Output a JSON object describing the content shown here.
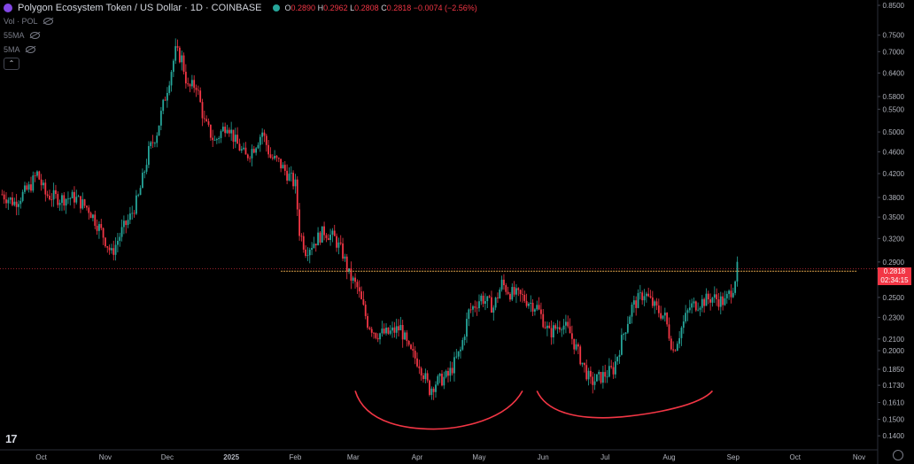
{
  "header": {
    "title": "Polygon Ecosystem Token / US Dollar · 1D · COINBASE",
    "ohlc": {
      "o_label": "O",
      "o": "0.2890",
      "h_label": "H",
      "h": "0.2962",
      "l_label": "L",
      "l": "0.2808",
      "c_label": "C",
      "c": "0.2818",
      "change": "−0.0074 (−2.56%)"
    }
  },
  "indicators": [
    "Vol · POL",
    "55MA",
    "5MA"
  ],
  "last_price": {
    "value": "0.2818",
    "countdown": "02:34:15"
  },
  "colors": {
    "up": "#26a69a",
    "down": "#f23645",
    "grid": "#2a2e39",
    "background": "#000000",
    "drawing": "#f23645"
  },
  "chart_data": {
    "type": "candlestick",
    "y_scale": "log",
    "ylim": [
      0.137,
      0.85
    ],
    "xlim": [
      "2024-09-11",
      "2025-11-10"
    ],
    "y_ticks": [
      "0.8500",
      "0.7500",
      "0.7000",
      "0.6400",
      "0.5800",
      "0.5500",
      "0.5000",
      "0.4600",
      "0.4200",
      "0.3800",
      "0.3500",
      "0.3200",
      "0.2900",
      "0.2700",
      "0.2500",
      "0.2300",
      "0.2100",
      "0.2000",
      "0.1850",
      "0.1730",
      "0.1610",
      "0.1500",
      "0.1400"
    ],
    "x_ticks": [
      {
        "label": "Oct",
        "date": "2024-10-01"
      },
      {
        "label": "Nov",
        "date": "2024-11-01"
      },
      {
        "label": "Dec",
        "date": "2024-12-01"
      },
      {
        "label": "2025",
        "date": "2025-01-01"
      },
      {
        "label": "Feb",
        "date": "2025-02-01"
      },
      {
        "label": "Mar",
        "date": "2025-03-01"
      },
      {
        "label": "Apr",
        "date": "2025-04-01"
      },
      {
        "label": "May",
        "date": "2025-05-01"
      },
      {
        "label": "Jun",
        "date": "2025-06-01"
      },
      {
        "label": "Jul",
        "date": "2025-07-01"
      },
      {
        "label": "Aug",
        "date": "2025-08-01"
      },
      {
        "label": "Sep",
        "date": "2025-09-01"
      },
      {
        "label": "Oct",
        "date": "2025-10-01"
      },
      {
        "label": "Nov",
        "date": "2025-11-01"
      }
    ],
    "close_path": [
      [
        "2024-09-12",
        0.385
      ],
      [
        "2024-09-18",
        0.372
      ],
      [
        "2024-09-25",
        0.395
      ],
      [
        "2024-09-29",
        0.42
      ],
      [
        "2024-10-03",
        0.385
      ],
      [
        "2024-10-10",
        0.378
      ],
      [
        "2024-10-17",
        0.38
      ],
      [
        "2024-10-24",
        0.362
      ],
      [
        "2024-10-30",
        0.33
      ],
      [
        "2024-11-04",
        0.3
      ],
      [
        "2024-11-09",
        0.33
      ],
      [
        "2024-11-13",
        0.35
      ],
      [
        "2024-11-17",
        0.38
      ],
      [
        "2024-11-22",
        0.46
      ],
      [
        "2024-11-26",
        0.5
      ],
      [
        "2024-11-30",
        0.58
      ],
      [
        "2024-12-05",
        0.7
      ],
      [
        "2024-12-08",
        0.68
      ],
      [
        "2024-12-11",
        0.6
      ],
      [
        "2024-12-15",
        0.61
      ],
      [
        "2024-12-19",
        0.52
      ],
      [
        "2024-12-24",
        0.48
      ],
      [
        "2024-12-30",
        0.52
      ],
      [
        "2025-01-03",
        0.48
      ],
      [
        "2025-01-08",
        0.45
      ],
      [
        "2025-01-12",
        0.47
      ],
      [
        "2025-01-16",
        0.5
      ],
      [
        "2025-01-20",
        0.45
      ],
      [
        "2025-01-24",
        0.44
      ],
      [
        "2025-01-28",
        0.42
      ],
      [
        "2025-02-01",
        0.4
      ],
      [
        "2025-02-03",
        0.33
      ],
      [
        "2025-02-06",
        0.305
      ],
      [
        "2025-02-10",
        0.315
      ],
      [
        "2025-02-15",
        0.33
      ],
      [
        "2025-02-20",
        0.32
      ],
      [
        "2025-02-24",
        0.3
      ],
      [
        "2025-02-27",
        0.275
      ],
      [
        "2025-03-03",
        0.26
      ],
      [
        "2025-03-08",
        0.225
      ],
      [
        "2025-03-12",
        0.215
      ],
      [
        "2025-03-18",
        0.215
      ],
      [
        "2025-03-24",
        0.22
      ],
      [
        "2025-03-28",
        0.2
      ],
      [
        "2025-04-02",
        0.19
      ],
      [
        "2025-04-07",
        0.17
      ],
      [
        "2025-04-10",
        0.175
      ],
      [
        "2025-04-16",
        0.18
      ],
      [
        "2025-04-22",
        0.2
      ],
      [
        "2025-04-26",
        0.235
      ],
      [
        "2025-05-02",
        0.25
      ],
      [
        "2025-05-08",
        0.24
      ],
      [
        "2025-05-12",
        0.265
      ],
      [
        "2025-05-16",
        0.255
      ],
      [
        "2025-05-22",
        0.25
      ],
      [
        "2025-05-29",
        0.24
      ],
      [
        "2025-06-04",
        0.215
      ],
      [
        "2025-06-10",
        0.225
      ],
      [
        "2025-06-14",
        0.215
      ],
      [
        "2025-06-20",
        0.19
      ],
      [
        "2025-06-24",
        0.175
      ],
      [
        "2025-06-30",
        0.18
      ],
      [
        "2025-07-05",
        0.185
      ],
      [
        "2025-07-10",
        0.215
      ],
      [
        "2025-07-14",
        0.24
      ],
      [
        "2025-07-20",
        0.255
      ],
      [
        "2025-07-25",
        0.24
      ],
      [
        "2025-07-30",
        0.23
      ],
      [
        "2025-08-03",
        0.2
      ],
      [
        "2025-08-07",
        0.22
      ],
      [
        "2025-08-11",
        0.24
      ],
      [
        "2025-08-16",
        0.245
      ],
      [
        "2025-08-22",
        0.25
      ],
      [
        "2025-08-28",
        0.245
      ],
      [
        "2025-09-01",
        0.262
      ],
      [
        "2025-09-03",
        0.282
      ]
    ],
    "horizontal_line": {
      "value": 0.279,
      "from": "2025-01-25",
      "to": "2025-10-31"
    },
    "annotations": [
      {
        "type": "arc",
        "from": "2025-03-02",
        "to": "2025-05-22",
        "low_date": "2025-04-09",
        "top_price": 0.169,
        "bottom_price": 0.144
      },
      {
        "type": "arc",
        "from": "2025-05-29",
        "to": "2025-08-22",
        "low_date": "2025-06-30",
        "top_price": 0.169,
        "bottom_price": 0.151
      }
    ]
  }
}
